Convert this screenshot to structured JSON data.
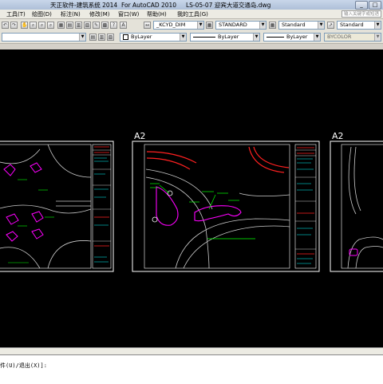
{
  "title": "天正软件-建筑系统 2014  For AutoCAD 2010     LS-05-07 迎宾大道交通岛.dwg",
  "window_buttons": [
    "_",
    "□"
  ],
  "menu": {
    "items": [
      "工具(T)",
      "绘图(D)",
      "标注(N)",
      "修改(M)",
      "窗口(W)",
      "帮助(H)",
      "我的工具(G)"
    ],
    "search_placeholder": "输入关键字或短语"
  },
  "toolbar1": {
    "dimstyle": "_KCYD_DIM",
    "textstyle": "STANDARD",
    "tablestyle": "Standard",
    "mlstyle": "Standard"
  },
  "toolbar2": {
    "layer_color": "ByLayer",
    "linetype": "ByLayer",
    "lineweight": "ByLayer",
    "plotstyle": "BYCOLOR"
  },
  "drawing": {
    "sheets": [
      {
        "label": ""
      },
      {
        "label": "A2"
      },
      {
        "label": "A2"
      }
    ]
  },
  "command": {
    "line": "件(U)/退出(X)]:"
  },
  "colors": {
    "background": "#000000",
    "frame": "#ffffff",
    "accent_magenta": "#ff00ff",
    "accent_cyan": "#00ffff",
    "accent_red": "#ff2020",
    "accent_green": "#00ff00"
  }
}
